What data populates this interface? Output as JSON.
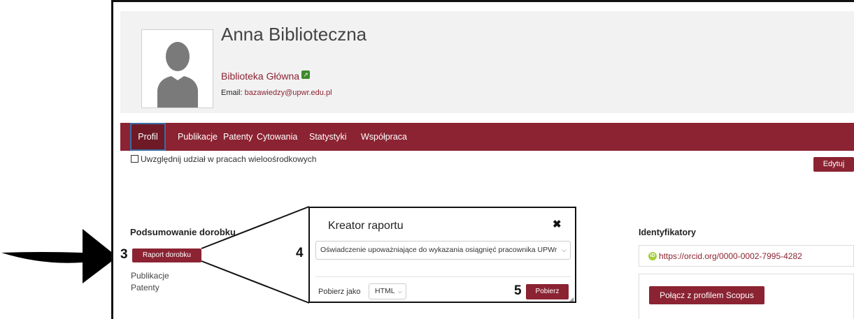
{
  "profile": {
    "name": "Anna Biblioteczna",
    "unit": "Biblioteka Główna",
    "email_label": "Email:",
    "email": "bazawiedzy@upwr.edu.pl"
  },
  "nav": {
    "tabs": [
      {
        "label": "Profil"
      },
      {
        "label": "Publikacje"
      },
      {
        "label": "Patenty"
      },
      {
        "label": "Cytowania"
      },
      {
        "label": "Statystyki"
      },
      {
        "label": "Współpraca"
      }
    ]
  },
  "multicenter_label": "Uwzględnij udział w pracach wieloośrodkowych",
  "edit_label": "Edytuj",
  "summary": {
    "title": "Podsumowanie dorobku",
    "report_button": "Raport dorobku",
    "items": [
      "Publikacje",
      "Patenty"
    ]
  },
  "dialog": {
    "title": "Kreator raportu",
    "close": "✖",
    "report_type": "Oświadczenie upoważniające do wykazania osiągnięć pracownika UPWr",
    "download_as_label": "Pobierz jako",
    "format": "HTML",
    "download_button": "Pobierz"
  },
  "steps": {
    "s3": "3",
    "s4": "4",
    "s5": "5"
  },
  "identifiers": {
    "title": "Identyfikatory",
    "orcid": "https://orcid.org/0000-0002-7995-4282",
    "scopus_button": "Połącz z profilem Scopus"
  },
  "colors": {
    "brand": "#8b2332",
    "brand_dark": "#6e1a27",
    "orcid": "#a6ce39"
  }
}
